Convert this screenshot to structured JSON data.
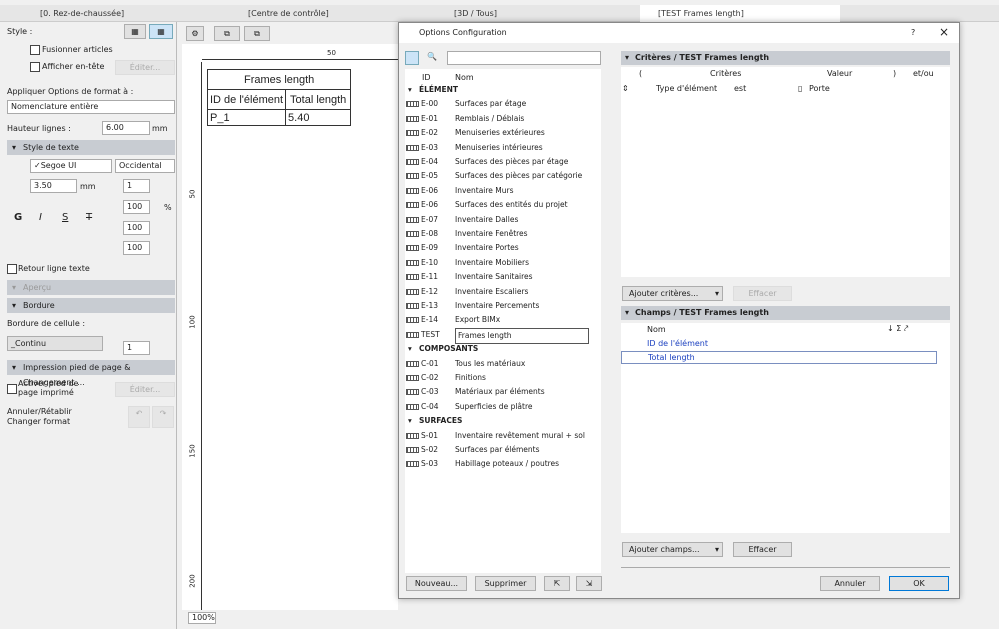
{
  "tabs": [
    "[0. Rez-de-chaussée]",
    "[Centre de contrôle]",
    "[3D / Tous]",
    "[TEST Frames length]"
  ],
  "left": {
    "style_label": "Style :",
    "merge": "Fusionner articles",
    "header": "Afficher en-tête",
    "edit": "Éditer...",
    "apply_label": "Appliquer Options de format à :",
    "apply_value": "Nomenclature entière",
    "row_height_label": "Hauteur lignes :",
    "row_height": "6.00",
    "mm": "mm",
    "text_style": "Style de texte",
    "font": "✓Segoe UI",
    "script": "Occidental",
    "font_size": "3.50",
    "pen": "1",
    "bold": "G",
    "italic": "I",
    "underline": "S",
    "strike": "T",
    "pct1": "100",
    "pct2": "100",
    "pct3": "100",
    "pct": "%",
    "wrap": "Retour ligne texte",
    "preview": "Aperçu",
    "border": "Bordure",
    "cell_border": "Bordure de cellule :",
    "line_type": "_Continu",
    "border_pen": "1",
    "print_footer": "Impression pied de page & Changement ...",
    "activate_footer": "Activer pied de page imprimé",
    "edit2": "Éditer...",
    "undo": "Annuler/Rétablir",
    "change_format": "Changer format"
  },
  "canvas": {
    "ruler_50": "50",
    "v50": "50",
    "v100": "100",
    "v150": "150",
    "v200": "200",
    "table_title": "Frames length",
    "col1": "ID de l'élément",
    "col2": "Total length",
    "cell1": "P_1",
    "cell2": "5.40",
    "zoom": "100%"
  },
  "dialog": {
    "title": "Options Configuration",
    "help": "?",
    "close": "×",
    "col_id": "ID",
    "col_name": "Nom",
    "list": [
      {
        "sec": true,
        "name": "ÉLÉMENT"
      },
      {
        "id": "E-00",
        "name": "Surfaces par étage"
      },
      {
        "id": "E-01",
        "name": "Remblais / Déblais"
      },
      {
        "id": "E-02",
        "name": "Menuiseries extérieures"
      },
      {
        "id": "E-03",
        "name": "Menuiseries intérieures"
      },
      {
        "id": "E-04",
        "name": "Surfaces des pièces par étage"
      },
      {
        "id": "E-05",
        "name": "Surfaces des pièces par catégorie"
      },
      {
        "id": "E-06",
        "name": "Inventaire Murs"
      },
      {
        "id": "E-06",
        "name": "Surfaces des entités du projet"
      },
      {
        "id": "E-07",
        "name": "Inventaire Dalles"
      },
      {
        "id": "E-08",
        "name": "Inventaire Fenêtres"
      },
      {
        "id": "E-09",
        "name": "Inventaire Portes"
      },
      {
        "id": "E-10",
        "name": "Inventaire Mobiliers"
      },
      {
        "id": "E-11",
        "name": "Inventaire Sanitaires"
      },
      {
        "id": "E-12",
        "name": "Inventaire Escaliers"
      },
      {
        "id": "E-13",
        "name": "Inventaire Percements"
      },
      {
        "id": "E-14",
        "name": "Export BIMx"
      },
      {
        "id": "TEST",
        "name": "Frames length",
        "sel": true
      },
      {
        "sec": true,
        "name": "COMPOSANTS"
      },
      {
        "id": "C-01",
        "name": "Tous les matériaux"
      },
      {
        "id": "C-02",
        "name": "Finitions"
      },
      {
        "id": "C-03",
        "name": "Matériaux par éléments"
      },
      {
        "id": "C-04",
        "name": "Superficies de plâtre"
      },
      {
        "sec": true,
        "name": "SURFACES"
      },
      {
        "id": "S-01",
        "name": "Inventaire revêtement mural + sol"
      },
      {
        "id": "S-02",
        "name": "Surfaces par éléments"
      },
      {
        "id": "S-03",
        "name": "Habillage poteaux / poutres"
      }
    ],
    "new": "Nouveau...",
    "delete": "Supprimer",
    "criteria_header": "Critères / TEST Frames length",
    "c_paren_open": "(",
    "c_criteria": "Critères",
    "c_value": "Valeur",
    "c_paren_close": ")",
    "c_andor": "et/ou",
    "crit_row": {
      "criterion": "Type d'élément",
      "op": "est",
      "value": "Porte"
    },
    "add_criteria": "Ajouter critères...",
    "clear1": "Effacer",
    "fields_header": "Champs / TEST Frames length",
    "f_name": "Nom",
    "fields": [
      "ID de l'élément",
      "Total length"
    ],
    "add_fields": "Ajouter champs...",
    "clear2": "Effacer",
    "cancel": "Annuler",
    "ok": "OK"
  }
}
